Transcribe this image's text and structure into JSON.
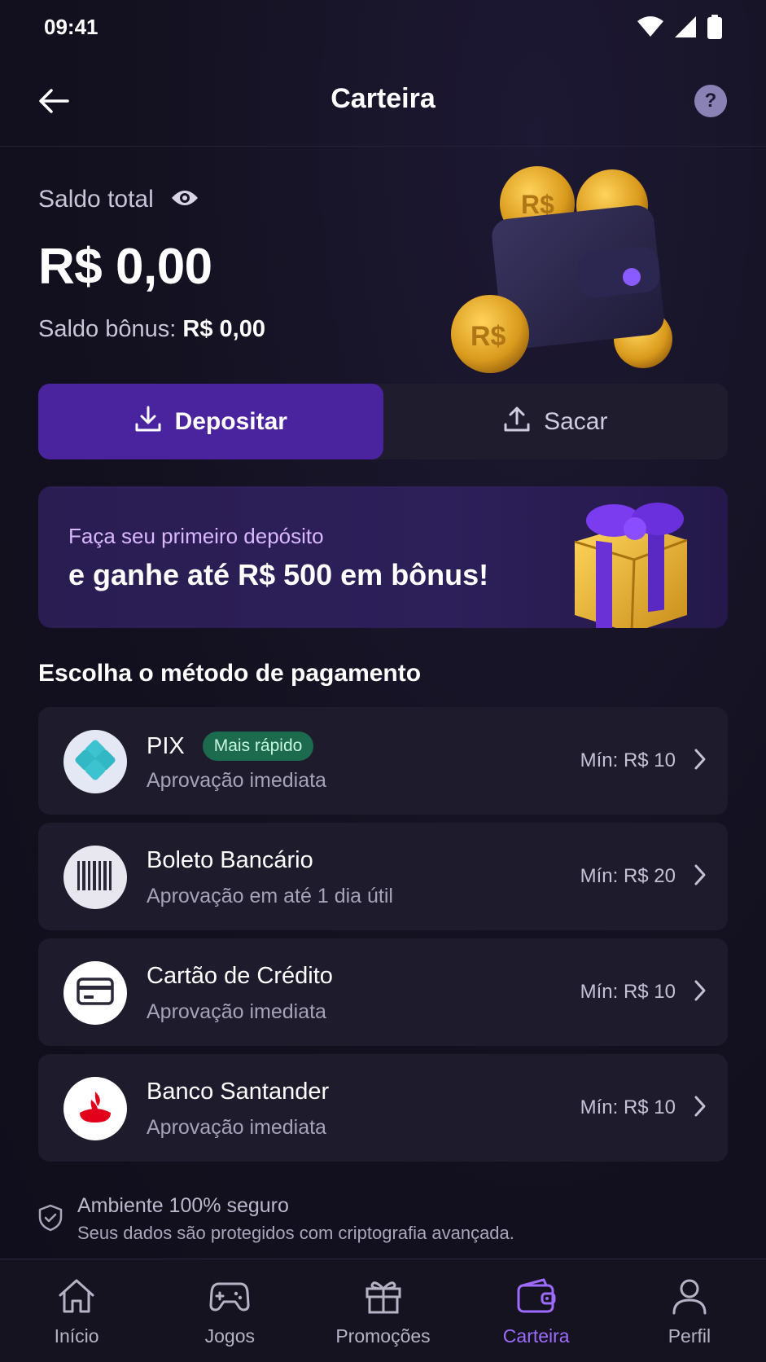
{
  "status_bar": {
    "time": "09:41"
  },
  "header": {
    "title": "Carteira",
    "help_glyph": "?"
  },
  "balance": {
    "label": "Saldo total",
    "value": "R$ 0,00",
    "bonus_label": "Saldo bônus:",
    "bonus_value": "R$ 0,00"
  },
  "actions": {
    "deposit_label": "Depositar",
    "withdraw_label": "Sacar"
  },
  "promo": {
    "subtitle": "Faça seu primeiro depósito",
    "title": "e ganhe até R$ 500 em bônus!"
  },
  "payment_section_title": "Escolha o método de pagamento",
  "payment_methods": [
    {
      "name": "PIX",
      "badge": "Mais rápido",
      "description": "Aprovação imediata",
      "min": "Mín: R$ 10",
      "icon": "pix-icon"
    },
    {
      "name": "Boleto Bancário",
      "description": "Aprovação em até 1 dia útil",
      "min": "Mín: R$ 20",
      "icon": "barcode-icon"
    },
    {
      "name": "Cartão de Crédito",
      "description": "Aprovação imediata",
      "min": "Mín: R$ 10",
      "icon": "credit-card-icon"
    },
    {
      "name": "Banco Santander",
      "description": "Aprovação imediata",
      "min": "Mín: R$ 10",
      "icon": "santander-flame-icon"
    }
  ],
  "security": {
    "title": "Ambiente 100% seguro",
    "description": "Seus dados são protegidos com criptografia avançada."
  },
  "bottom_nav": [
    {
      "label": "Início",
      "icon": "home-icon",
      "active": false
    },
    {
      "label": "Jogos",
      "icon": "gamepad-icon",
      "active": false
    },
    {
      "label": "Promoções",
      "icon": "gift-icon",
      "active": false
    },
    {
      "label": "Carteira",
      "icon": "wallet-icon",
      "active": true
    },
    {
      "label": "Perfil",
      "icon": "user-icon",
      "active": false
    }
  ],
  "colors": {
    "background": "#13111f",
    "accent_purple": "#4a249e",
    "active_nav": "#9d6bff",
    "badge_green": "#1d6b4f"
  }
}
